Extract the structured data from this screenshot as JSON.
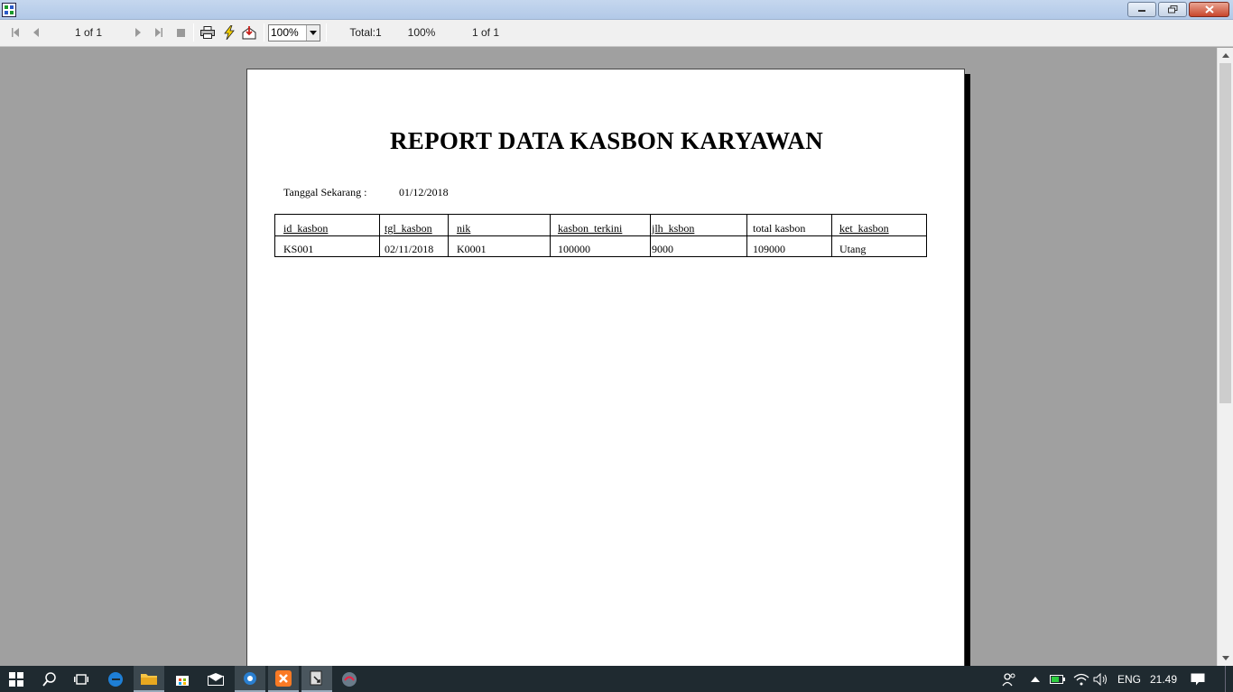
{
  "toolbar": {
    "page_indicator": "1 of 1",
    "zoom_value": "100%",
    "total_label": "Total:1",
    "zoom_percent": "100%",
    "page_count": "1 of 1"
  },
  "report": {
    "title": "REPORT DATA KASBON KARYAWAN",
    "date_label": "Tanggal Sekarang  :",
    "date_value": "01/12/2018",
    "columns": [
      "id_kasbon",
      "tgl_kasbon",
      "nik",
      "kasbon_terkini",
      "jlh_ksbon",
      "total  kasbon",
      "ket_kasbon"
    ],
    "rows": [
      [
        "KS001",
        "02/11/2018",
        "K0001",
        "100000",
        "9000",
        "109000",
        "Utang"
      ]
    ]
  },
  "taskbar": {
    "language": "ENG",
    "time": "21.49"
  },
  "colors": {
    "titlebar": "#b8cde9",
    "viewport": "#a0a0a0",
    "taskbar": "#1f2a30",
    "close_button": "#c8452b"
  },
  "icons": {
    "app": "report-viewer-icon",
    "first": "first-page-icon",
    "prev": "prev-page-icon",
    "next": "next-page-icon",
    "last": "last-page-icon",
    "stop": "stop-icon",
    "print": "printer-icon",
    "refresh": "lightning-icon",
    "export": "export-icon"
  }
}
